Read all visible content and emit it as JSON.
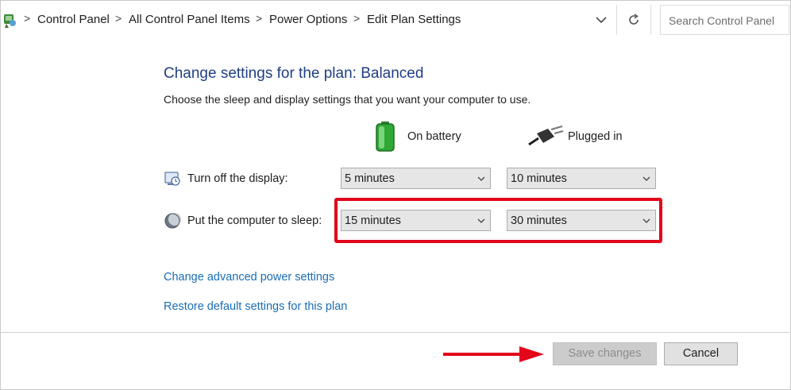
{
  "breadcrumb": {
    "items": [
      "Control Panel",
      "All Control Panel Items",
      "Power Options",
      "Edit Plan Settings"
    ],
    "separator": ">"
  },
  "icons": {
    "control_panel": "control-panel-icon",
    "dropdown": "chevron-down-icon",
    "refresh": "refresh-icon",
    "battery": "battery-icon",
    "plug": "power-plug-icon",
    "display": "display-icon",
    "sleep": "moon-icon",
    "arrow": "red-arrow-icon"
  },
  "search": {
    "placeholder": "Search Control Panel"
  },
  "page": {
    "title": "Change settings for the plan: Balanced",
    "subtitle": "Choose the sleep and display settings that you want your computer to use."
  },
  "columns": {
    "battery": "On battery",
    "plugged": "Plugged in"
  },
  "rows": [
    {
      "label": "Turn off the display:",
      "battery": "5 minutes",
      "plugged": "10 minutes"
    },
    {
      "label": "Put the computer to sleep:",
      "battery": "15 minutes",
      "plugged": "30 minutes"
    }
  ],
  "links": {
    "advanced": "Change advanced power settings",
    "restore": "Restore default settings for this plan"
  },
  "buttons": {
    "save": "Save changes",
    "cancel": "Cancel"
  },
  "colors": {
    "title": "#1f3e84",
    "link": "#1a6db5",
    "highlight": "#e3051a",
    "arrow": "#e3051a"
  }
}
